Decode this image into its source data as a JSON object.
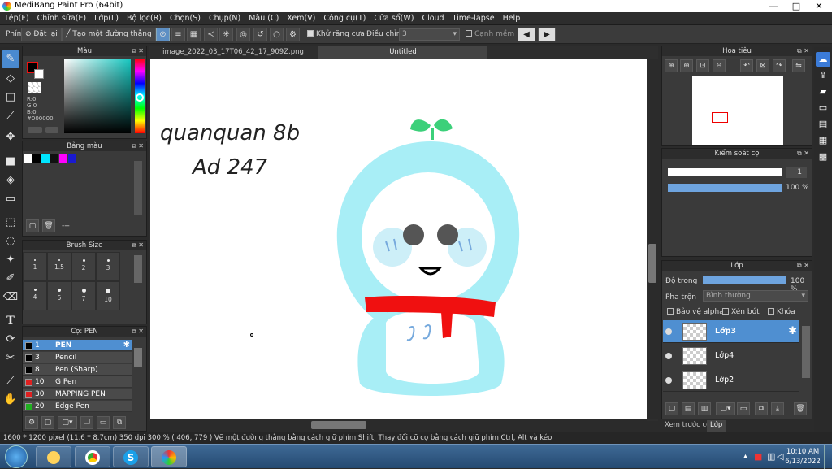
{
  "window": {
    "title": "MediBang Paint Pro (64bit)",
    "minimize": "—",
    "maximize": "□",
    "close": "✕"
  },
  "menu": [
    "Tệp(F)",
    "Chỉnh sửa(E)",
    "Lớp(L)",
    "Bộ lọc(R)",
    "Chọn(S)",
    "Chụp(N)",
    "Màu (C)",
    "Xem(V)",
    "Công cụ(T)",
    "Cửa sổ(W)",
    "Cloud",
    "Time-lapse",
    "Help"
  ],
  "toolbar": {
    "label": "Phím",
    "reset": "Đặt lại",
    "straight_line": "Tạo một đường thẳng",
    "antialias": "Khử răng cưa",
    "correction_label": "Điều chỉnh",
    "correction_value": "3",
    "overflow": "Cạnh mềm"
  },
  "color_panel": {
    "title": "Màu",
    "r": "R:0",
    "g": "G:0",
    "b": "B:0",
    "hex": "#000000"
  },
  "palette_panel": {
    "title": "Bảng màu",
    "more": "---"
  },
  "brush_size_panel": {
    "title": "Brush Size",
    "sizes": [
      "1",
      "1.5",
      "2",
      "3",
      "4",
      "5",
      "7",
      "10"
    ]
  },
  "brush_panel": {
    "title": "Cọ: PEN",
    "items": [
      {
        "size": "1",
        "name": "PEN",
        "color": "#000000"
      },
      {
        "size": "3",
        "name": "Pencil",
        "color": "#000000"
      },
      {
        "size": "8",
        "name": "Pen (Sharp)",
        "color": "#000000"
      },
      {
        "size": "10",
        "name": "G Pen",
        "color": "#e02020"
      },
      {
        "size": "30",
        "name": "MAPPING PEN",
        "color": "#e02020"
      },
      {
        "size": "20",
        "name": "Edge Pen",
        "color": "#20b020"
      }
    ]
  },
  "tabs": [
    {
      "label": "image_2022_03_17T06_42_17_909Z.png"
    },
    {
      "label": "Untitled"
    }
  ],
  "canvas": {
    "handwriting_line1": "quanquan 8b",
    "handwriting_line2": "Ad 247"
  },
  "navigator_panel": {
    "title": "Hoa tiêu"
  },
  "brush_control_panel": {
    "title": "Kiểm soát cọ",
    "size_value": "1",
    "opacity_value": "100 %"
  },
  "layer_panel": {
    "title": "Lớp",
    "opacity_label": "Độ trong",
    "opacity_value": "100 %",
    "blend_label": "Pha trộn",
    "blend_value": "Bình thường",
    "protect_alpha": "Bảo vệ alpha",
    "clipping": "Xén bớt",
    "lock": "Khóa",
    "layers": [
      "Lớp3",
      "Lớp4",
      "Lớp2"
    ]
  },
  "bottom_tabs": {
    "preview": "Xem trước cọ",
    "layer": "Lớp"
  },
  "status": {
    "size": "1600 * 1200 pixel",
    "cm": "(11.6 * 8.7cm)",
    "dpi": "350 dpi",
    "zoom": "300 %",
    "coords": "( 406, 779 )",
    "hint": "Vẽ một đường thẳng bằng cách giữ phím Shift, Thay đổi cỡ cọ bằng cách giữ phím Ctrl, Alt và kéo"
  },
  "taskbar": {
    "time": "10:10 AM",
    "date": "6/13/2022"
  },
  "colors": {
    "accent": "#4a90d9",
    "figure": "#a8eef6",
    "scarf": "#f01010",
    "leaf": "#3cd07a"
  }
}
